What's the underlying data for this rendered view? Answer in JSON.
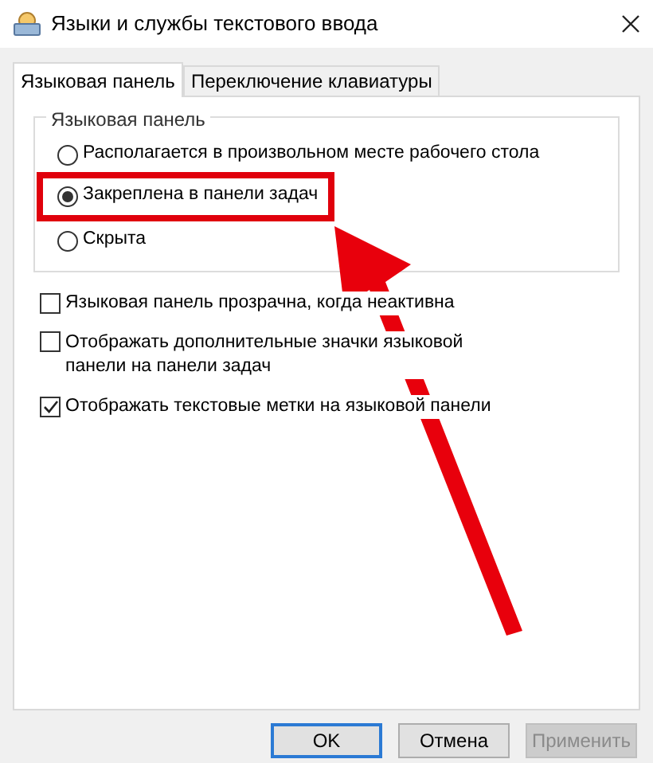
{
  "window": {
    "title": "Языки и службы текстового ввода"
  },
  "tabs": [
    {
      "label": "Языковая панель",
      "selected": true
    },
    {
      "label": "Переключение клавиатуры",
      "selected": false
    }
  ],
  "group": {
    "title": "Языковая панель",
    "options": [
      {
        "label": "Располагается в произвольном месте рабочего стола",
        "selected": false
      },
      {
        "label": "Закреплена в панели задач",
        "selected": true
      },
      {
        "label": "Скрыта",
        "selected": false
      }
    ]
  },
  "checkboxes": [
    {
      "label": "Языковая панель прозрачна, когда неактивна",
      "checked": false
    },
    {
      "label": "Отображать дополнительные значки языковой панели на панели задач",
      "checked": false
    },
    {
      "label": "Отображать текстовые метки на языковой панели",
      "checked": true
    }
  ],
  "buttons": [
    {
      "label": "OK",
      "kind": "default",
      "disabled": false
    },
    {
      "label": "Отмена",
      "kind": "normal",
      "disabled": false
    },
    {
      "label": "Применить",
      "kind": "normal",
      "disabled": true
    }
  ]
}
